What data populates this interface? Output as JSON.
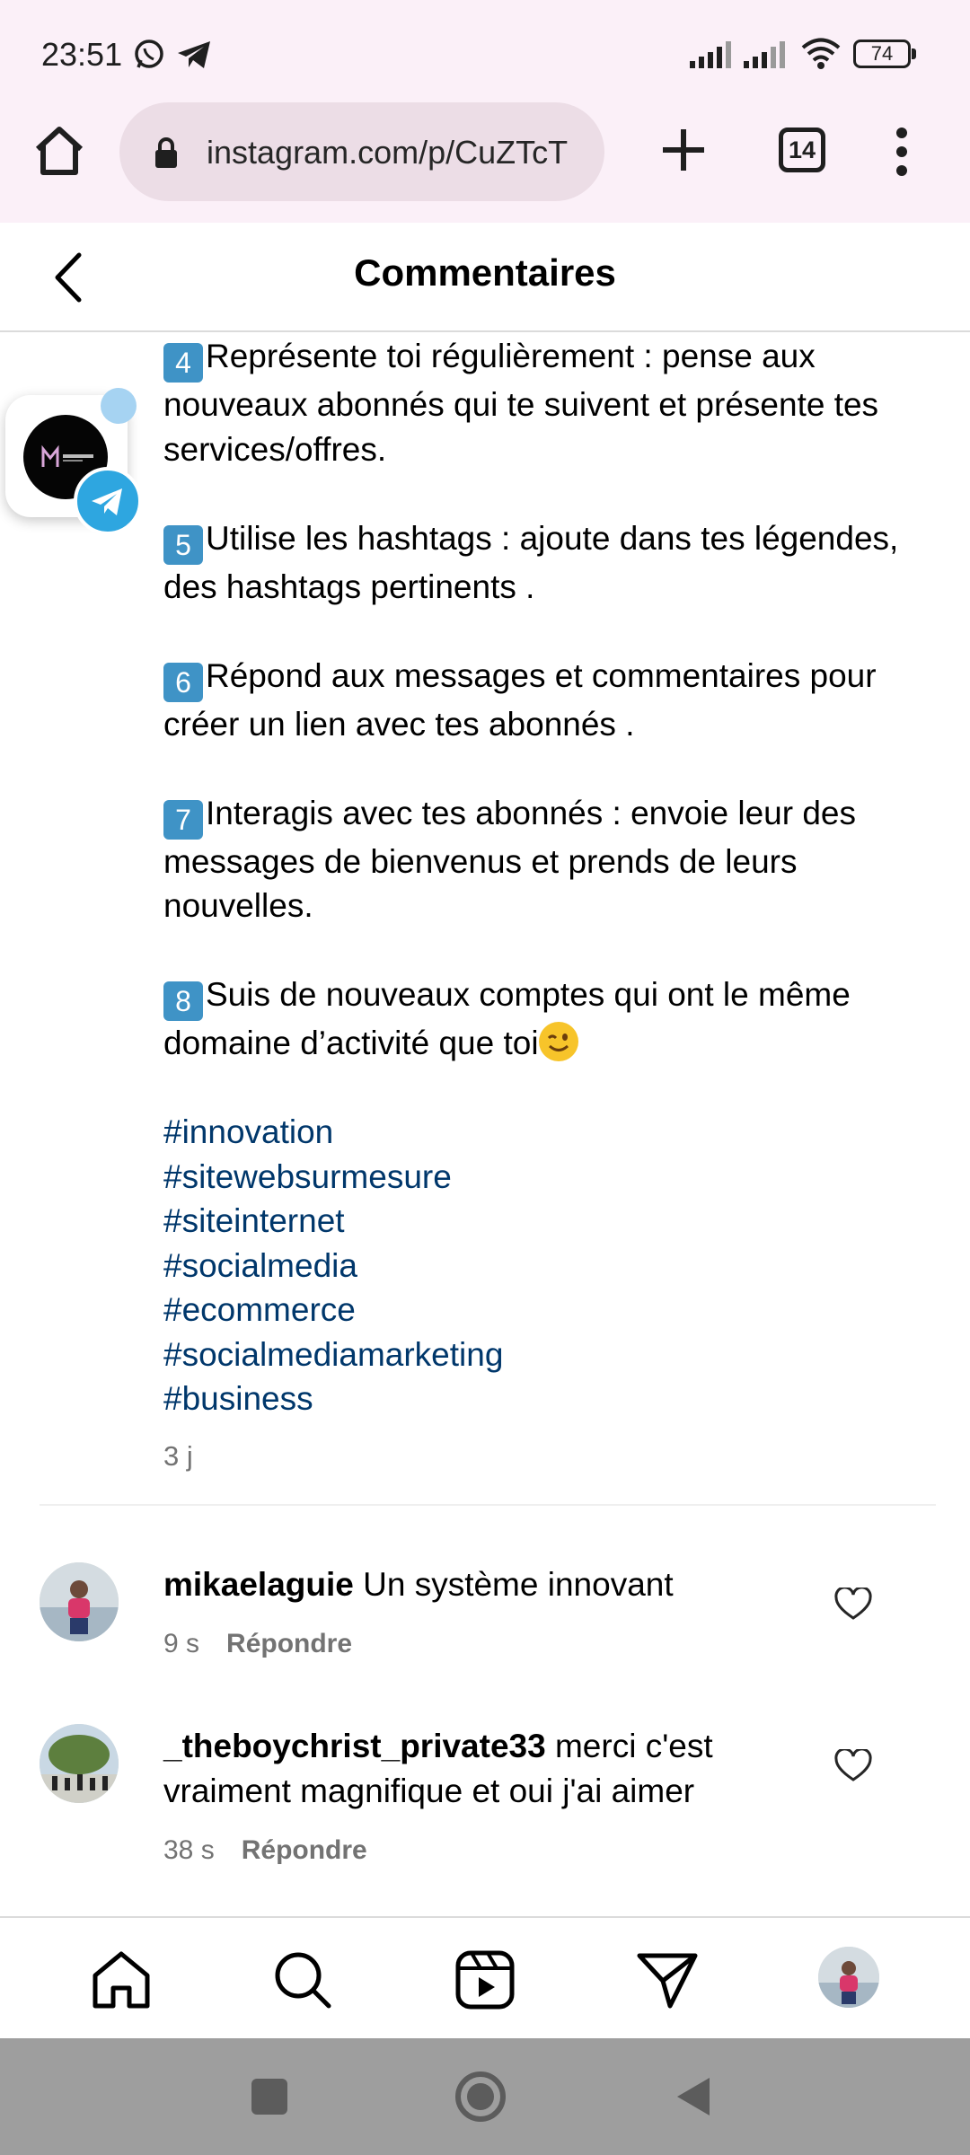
{
  "status_bar": {
    "time": "23:51",
    "battery": "74"
  },
  "browser": {
    "url": "instagram.com/p/CuZTcT",
    "tab_count": "14"
  },
  "header": {
    "title": "Commentaires"
  },
  "caption": {
    "paragraphs": [
      {
        "key": "4",
        "text": "Représente toi régulièrement : pense aux nouveaux abonnés qui te suivent et présente tes services/offres."
      },
      {
        "key": "5",
        "text": "Utilise les hashtags : ajoute dans tes légendes, des hashtags pertinents ."
      },
      {
        "key": "6",
        "text": "Répond aux messages et commentaires pour créer un lien avec tes abonnés ."
      },
      {
        "key": "7",
        "text": "Interagis avec tes abonnés : envoie leur des messages de bienvenus et prends de leurs nouvelles."
      },
      {
        "key": "8",
        "text": "Suis de nouveaux comptes qui ont le même domaine d’activité que toi"
      }
    ],
    "hashtags": [
      "#innovation",
      "#sitewebsurmesure",
      "#siteinternet",
      "#socialmedia",
      "#ecommerce",
      "#socialmediamarketing",
      "#business"
    ],
    "time": "3 j"
  },
  "comments": [
    {
      "username": "mikaelaguie",
      "text": "Un système innovant",
      "time": "9 s",
      "reply": "Répondre"
    },
    {
      "username": "_theboychrist_private33",
      "text": "merci c'est vraiment magnifique et oui j'ai aimer",
      "time": "38 s",
      "reply": "Répondre"
    }
  ],
  "icons": {
    "status": [
      "whatsapp-icon",
      "telegram-icon",
      "signal-icon",
      "wifi-icon",
      "battery-icon"
    ],
    "browser": [
      "home-icon",
      "lock-icon",
      "plus-icon",
      "tabs-icon",
      "more-icon"
    ],
    "nav": [
      "home-icon",
      "search-icon",
      "reels-icon",
      "direct-icon",
      "profile-avatar"
    ],
    "system": [
      "recents-icon",
      "home-circle-icon",
      "back-triangle-icon"
    ]
  },
  "colors": {
    "hashtag": "#00376b",
    "keycap": "#3f93c6",
    "browser_bg": "#fbf0f8",
    "system_nav": "#9e9e9e"
  }
}
